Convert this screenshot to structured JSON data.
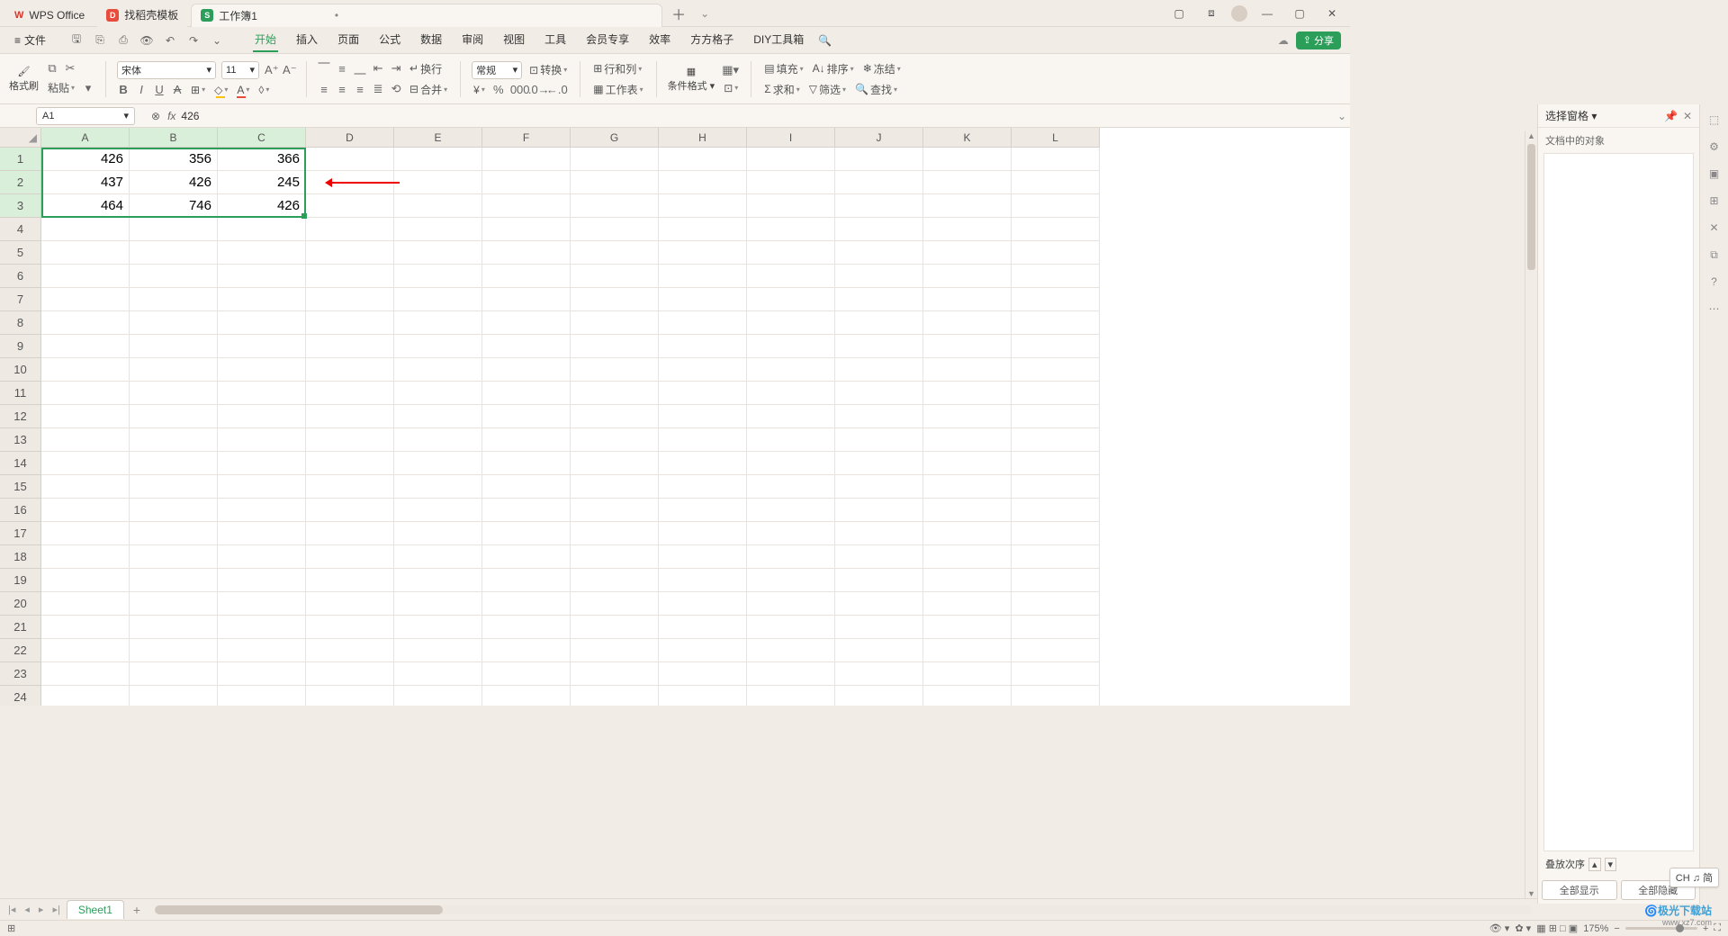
{
  "titlebar": {
    "wps": "WPS Office",
    "template_tab": "找稻壳模板",
    "sheet_tab": "工作簿1",
    "sheet_icon": "S",
    "doc_icon": "D"
  },
  "menubar": {
    "file": "文件",
    "menus": [
      "开始",
      "插入",
      "页面",
      "公式",
      "数据",
      "审阅",
      "视图",
      "工具",
      "会员专享",
      "效率",
      "方方格子",
      "DIY工具箱"
    ],
    "active": 0,
    "share": "分享"
  },
  "ribbon": {
    "format_brush": "格式刷",
    "paste": "粘贴",
    "font_name": "宋体",
    "font_size": "11",
    "number_format": "常规",
    "convert": "转换",
    "wrap": "换行",
    "merge": "合并",
    "row_col": "行和列",
    "worksheet": "工作表",
    "cond_fmt": "条件格式",
    "fill": "填充",
    "sort": "排序",
    "freeze": "冻结",
    "sum": "求和",
    "filter": "筛选",
    "find": "查找"
  },
  "formula_bar": {
    "name": "A1",
    "fx": "fx",
    "value": "426"
  },
  "columns": [
    "A",
    "B",
    "C",
    "D",
    "E",
    "F",
    "G",
    "H",
    "I",
    "J",
    "K",
    "L"
  ],
  "rows": 24,
  "sel_cols": 3,
  "sel_rows": 3,
  "chart_data": {
    "type": "table",
    "grid": [
      [
        "426",
        "356",
        "366"
      ],
      [
        "437",
        "426",
        "245"
      ],
      [
        "464",
        "746",
        "426"
      ]
    ]
  },
  "right_panel": {
    "title": "选择窗格",
    "sub": "文档中的对象",
    "stack_order": "叠放次序",
    "show_all": "全部显示",
    "hide_all": "全部隐藏"
  },
  "sheet_tabs": {
    "tab1": "Sheet1"
  },
  "statusbar": {
    "zoom": "175%",
    "ime": "CH ♫ 简"
  },
  "watermark": {
    "brand": "极光下载站",
    "url": "www.xz7.com"
  }
}
